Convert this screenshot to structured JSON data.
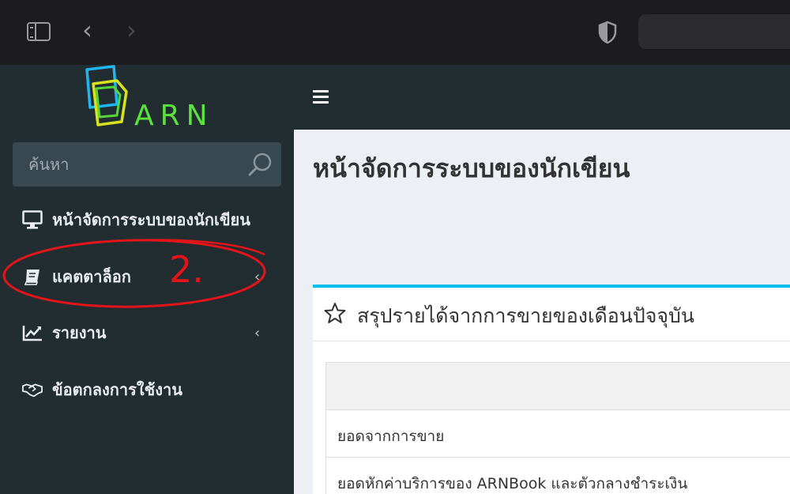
{
  "browser": {
    "back_glyph": "‹",
    "forward_glyph": "›"
  },
  "sidebar": {
    "logo_text": "ARN",
    "search_placeholder": "ค้นหา",
    "items": [
      {
        "label": "หน้าจัดการระบบของนักเขียน",
        "icon": "monitor-icon"
      },
      {
        "label": "แคตตาล็อก",
        "icon": "book-icon",
        "chevron": "‹"
      },
      {
        "label": "รายงาน",
        "icon": "line-chart-icon",
        "chevron": "‹"
      },
      {
        "label": "ข้อตกลงการใช้งาน",
        "icon": "handshake-icon"
      }
    ]
  },
  "annotation": {
    "text": "2.",
    "color": "#e1151a"
  },
  "main": {
    "page_title": "หน้าจัดการระบบของนักเขียน",
    "box_title": "สรุปรายได้จากการขายของเดือนปัจจุบัน",
    "table_rows": [
      "ยอดจากการขาย",
      "ยอดหักค่าบริการของ ARNBook และตัวกลางชำระเงิน"
    ]
  },
  "colors": {
    "sidebar_bg": "#222d32",
    "accent": "#00c0ef",
    "logo_green": "#5be33d"
  }
}
